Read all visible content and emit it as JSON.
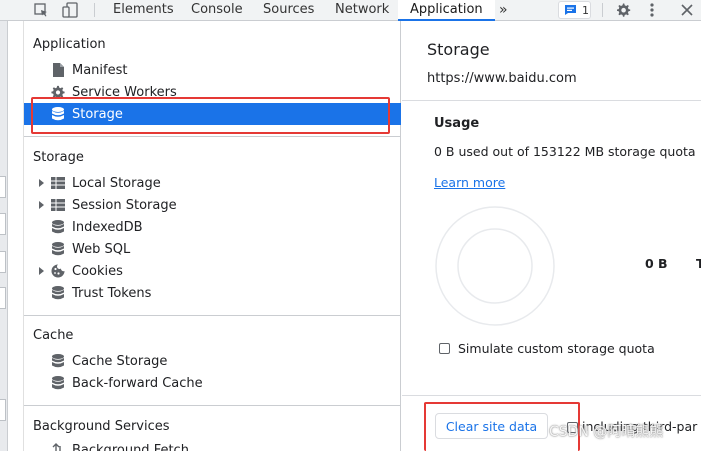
{
  "toolbar": {
    "tabs": [
      "Elements",
      "Console",
      "Sources",
      "Network",
      "Application"
    ],
    "more": "»",
    "issues_count": "1",
    "icons": [
      "inspect-element-icon",
      "device-toolbar-icon",
      "overflow-tabs-icon",
      "message-badge-icon",
      "gear-icon",
      "kebab-menu-icon",
      "close-icon"
    ]
  },
  "sidebar": {
    "sections": [
      {
        "title": "Application",
        "items": [
          {
            "label": "Manifest",
            "icon": "document-icon"
          },
          {
            "label": "Service Workers",
            "icon": "gear-icon"
          },
          {
            "label": "Storage",
            "icon": "database-icon",
            "selected": true
          }
        ]
      },
      {
        "title": "Storage",
        "items": [
          {
            "label": "Local Storage",
            "icon": "grid-icon",
            "expandable": true
          },
          {
            "label": "Session Storage",
            "icon": "grid-icon",
            "expandable": true
          },
          {
            "label": "IndexedDB",
            "icon": "database-icon"
          },
          {
            "label": "Web SQL",
            "icon": "database-icon"
          },
          {
            "label": "Cookies",
            "icon": "cookie-icon",
            "expandable": true
          },
          {
            "label": "Trust Tokens",
            "icon": "database-icon"
          }
        ]
      },
      {
        "title": "Cache",
        "items": [
          {
            "label": "Cache Storage",
            "icon": "database-icon"
          },
          {
            "label": "Back-forward Cache",
            "icon": "database-icon"
          }
        ]
      },
      {
        "title": "Background Services",
        "items": [
          {
            "label": "Background Fetch",
            "icon": "arrows-icon"
          }
        ]
      }
    ]
  },
  "main": {
    "title": "Storage",
    "origin": "https://www.baidu.com",
    "usage_title": "Usage",
    "usage_text": "0 B used out of 153122 MB storage quota",
    "learn_more": "Learn more",
    "total": "0 B",
    "total_cut": "T",
    "simulate_label": "Simulate custom storage quota",
    "simulate_checked": false,
    "clear_button": "Clear site data",
    "including_label": "including third-par",
    "watermark": "CSDN @阿晴熊熊"
  },
  "colors": {
    "selected_bg": "#1a73e8",
    "link": "#1a73e8",
    "annotation_red": "#e53935"
  }
}
